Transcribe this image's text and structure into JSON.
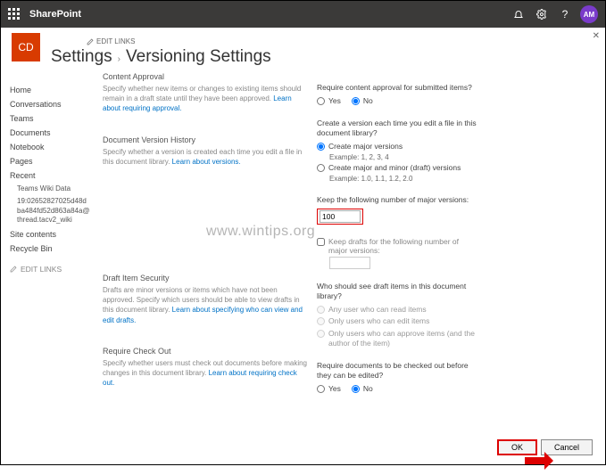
{
  "topbar": {
    "brand": "SharePoint",
    "avatar": "AM"
  },
  "editlinks_top": "EDIT LINKS",
  "page_tile": "CD",
  "breadcrumb": {
    "a": "Settings",
    "b": "Versioning Settings"
  },
  "nav": {
    "home": "Home",
    "conversations": "Conversations",
    "teams": "Teams",
    "documents": "Documents",
    "notebook": "Notebook",
    "pages": "Pages",
    "recent": "Recent",
    "recent_sub1": "Teams Wiki Data",
    "recent_sub2": "19:02652827025d48dba484fd52d863a84a@thread.tacv2_wiki",
    "site_contents": "Site contents",
    "recycle": "Recycle Bin",
    "editlinks": "EDIT LINKS"
  },
  "sections": {
    "content_approval": {
      "title": "Content Approval",
      "desc": "Specify whether new items or changes to existing items should remain in a draft state until they have been approved. ",
      "link": "Learn about requiring approval."
    },
    "version_history": {
      "title": "Document Version History",
      "desc": "Specify whether a version is created each time you edit a file in this document library. ",
      "link": "Learn about versions."
    },
    "draft_security": {
      "title": "Draft Item Security",
      "desc": "Drafts are minor versions or items which have not been approved. Specify which users should be able to view drafts in this document library. ",
      "link": "Learn about specifying who can view and edit drafts."
    },
    "checkout": {
      "title": "Require Check Out",
      "desc": "Specify whether users must check out documents before making changes in this document library. ",
      "link": "Learn about requiring check out."
    }
  },
  "controls": {
    "approval_q": "Require content approval for submitted items?",
    "yes": "Yes",
    "no": "No",
    "version_q": "Create a version each time you edit a file in this document library?",
    "major": "Create major versions",
    "major_ex": "Example: 1, 2, 3, 4",
    "minor": "Create major and minor (draft) versions",
    "minor_ex": "Example: 1.0, 1.1, 1.2, 2.0",
    "keep_major": "Keep the following number of major versions:",
    "keep_major_val": "100",
    "keep_drafts": "Keep drafts for the following number of major versions:",
    "who_q": "Who should see draft items in this document library?",
    "who1": "Any user who can read items",
    "who2": "Only users who can edit items",
    "who3": "Only users who can approve items (and the author of the item)",
    "checkout_q": "Require documents to be checked out before they can be edited?"
  },
  "buttons": {
    "ok": "OK",
    "cancel": "Cancel"
  },
  "watermark": "www.wintips.org"
}
